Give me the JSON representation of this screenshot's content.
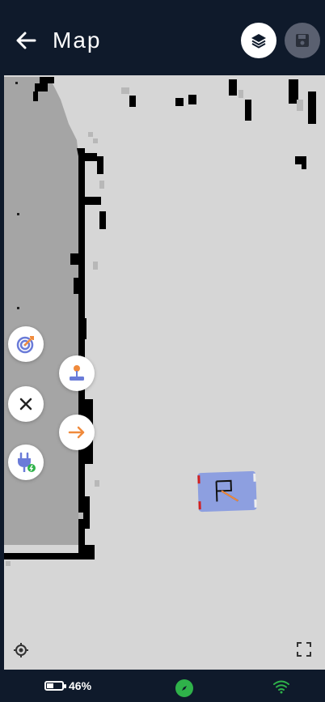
{
  "header": {
    "title": "Map"
  },
  "status": {
    "battery_text": "46%",
    "battery_level": 0.46
  },
  "colors": {
    "header_bg": "#0f1a2b",
    "map_free": "#d6d6d6",
    "map_unknown": "#a5a5a5",
    "map_wall": "#000000",
    "robot_body": "#8d9fe0",
    "accent_orange": "#f08a3c",
    "accent_green": "#2fb24a"
  },
  "icons": {
    "back": "arrow-left-icon",
    "layers": "layers-icon",
    "save": "floppy-disk-icon",
    "target": "target-icon",
    "close": "close-icon",
    "joystick": "joystick-icon",
    "arrow": "arrow-right-icon",
    "charger": "plug-icon",
    "locate": "crosshair-icon",
    "fullscreen": "fullscreen-icon",
    "compass": "compass-icon",
    "wifi": "wifi-icon"
  }
}
